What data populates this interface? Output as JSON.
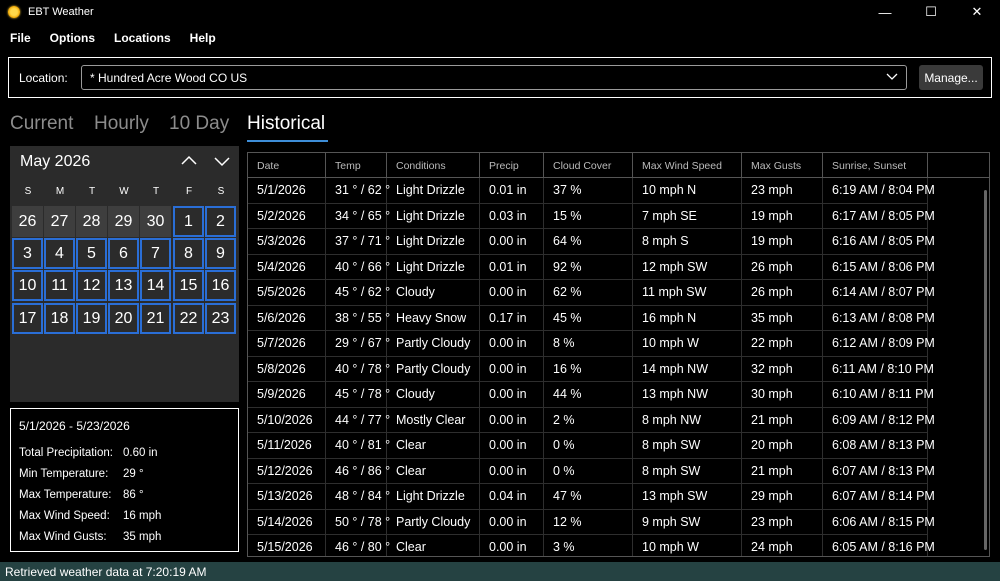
{
  "app": {
    "title": "EBT Weather"
  },
  "window_controls": {
    "minimize": "—",
    "maximize": "☐",
    "close": "✕"
  },
  "menu": [
    "File",
    "Options",
    "Locations",
    "Help"
  ],
  "location": {
    "label": "Location:",
    "value": "* Hundred Acre Wood CO US",
    "manage_label": "Manage..."
  },
  "tabs": [
    "Current",
    "Hourly",
    "10 Day",
    "Historical"
  ],
  "active_tab": "Historical",
  "calendar": {
    "month_label": "May 2026",
    "weekdays": [
      "S",
      "M",
      "T",
      "W",
      "T",
      "F",
      "S"
    ],
    "weeks": [
      [
        {
          "d": "26",
          "prev": true
        },
        {
          "d": "27",
          "prev": true
        },
        {
          "d": "28",
          "prev": true
        },
        {
          "d": "29",
          "prev": true
        },
        {
          "d": "30",
          "prev": true
        },
        {
          "d": "1"
        },
        {
          "d": "2"
        }
      ],
      [
        {
          "d": "3"
        },
        {
          "d": "4"
        },
        {
          "d": "5"
        },
        {
          "d": "6"
        },
        {
          "d": "7"
        },
        {
          "d": "8"
        },
        {
          "d": "9"
        }
      ],
      [
        {
          "d": "10"
        },
        {
          "d": "11"
        },
        {
          "d": "12"
        },
        {
          "d": "13"
        },
        {
          "d": "14"
        },
        {
          "d": "15"
        },
        {
          "d": "16"
        }
      ],
      [
        {
          "d": "17"
        },
        {
          "d": "18"
        },
        {
          "d": "19"
        },
        {
          "d": "20"
        },
        {
          "d": "21"
        },
        {
          "d": "22"
        },
        {
          "d": "23"
        }
      ]
    ]
  },
  "summary": {
    "range": "5/1/2026 - 5/23/2026",
    "rows": [
      {
        "label": "Total Precipitation:",
        "value": "0.60  in"
      },
      {
        "label": "Min Temperature:",
        "value": "29  °"
      },
      {
        "label": "Max Temperature:",
        "value": "86  °"
      },
      {
        "label": "Max Wind Speed:",
        "value": "16  mph"
      },
      {
        "label": "Max Wind Gusts:",
        "value": "35  mph"
      }
    ]
  },
  "grid": {
    "columns": [
      "Date",
      "Temp",
      "Conditions",
      "Precip",
      "Cloud Cover",
      "Max Wind Speed",
      "Max Gusts",
      "Sunrise, Sunset"
    ],
    "rows": [
      [
        "5/1/2026",
        "31 ° / 62 °",
        "Light Drizzle",
        "0.01 in",
        "37 %",
        "10 mph N",
        "23 mph",
        "6:19 AM / 8:04 PM"
      ],
      [
        "5/2/2026",
        "34 ° / 65 °",
        "Light Drizzle",
        "0.03 in",
        "15 %",
        "7 mph SE",
        "19 mph",
        "6:17 AM / 8:05 PM"
      ],
      [
        "5/3/2026",
        "37 ° / 71 °",
        "Light Drizzle",
        "0.00 in",
        "64 %",
        "8 mph S",
        "19 mph",
        "6:16 AM / 8:05 PM"
      ],
      [
        "5/4/2026",
        "40 ° / 66 °",
        "Light Drizzle",
        "0.01 in",
        "92 %",
        "12 mph SW",
        "26 mph",
        "6:15 AM / 8:06 PM"
      ],
      [
        "5/5/2026",
        "45 ° / 62 °",
        "Cloudy",
        "0.00 in",
        "62 %",
        "11 mph SW",
        "26 mph",
        "6:14 AM / 8:07 PM"
      ],
      [
        "5/6/2026",
        "38 ° / 55 °",
        "Heavy Snow",
        "0.17 in",
        "45 %",
        "16 mph N",
        "35 mph",
        "6:13 AM / 8:08 PM"
      ],
      [
        "5/7/2026",
        "29 ° / 67 °",
        "Partly Cloudy",
        "0.00 in",
        "8 %",
        "10 mph W",
        "22 mph",
        "6:12 AM / 8:09 PM"
      ],
      [
        "5/8/2026",
        "40 ° / 78 °",
        "Partly Cloudy",
        "0.00 in",
        "16 %",
        "14 mph NW",
        "32 mph",
        "6:11 AM / 8:10 PM"
      ],
      [
        "5/9/2026",
        "45 ° / 78 °",
        "Cloudy",
        "0.00 in",
        "44 %",
        "13 mph NW",
        "30 mph",
        "6:10 AM / 8:11 PM"
      ],
      [
        "5/10/2026",
        "44 ° / 77 °",
        "Mostly Clear",
        "0.00 in",
        "2 %",
        "8 mph NW",
        "21 mph",
        "6:09 AM / 8:12 PM"
      ],
      [
        "5/11/2026",
        "40 ° / 81 °",
        "Clear",
        "0.00 in",
        "0 %",
        "8 mph SW",
        "20 mph",
        "6:08 AM / 8:13 PM"
      ],
      [
        "5/12/2026",
        "46 ° / 86 °",
        "Clear",
        "0.00 in",
        "0 %",
        "8 mph SW",
        "21 mph",
        "6:07 AM / 8:13 PM"
      ],
      [
        "5/13/2026",
        "48 ° / 84 °",
        "Light Drizzle",
        "0.04 in",
        "47 %",
        "13 mph SW",
        "29 mph",
        "6:07 AM / 8:14 PM"
      ],
      [
        "5/14/2026",
        "50 ° / 78 °",
        "Partly Cloudy",
        "0.00 in",
        "12 %",
        "9 mph SW",
        "23 mph",
        "6:06 AM / 8:15 PM"
      ],
      [
        "5/15/2026",
        "46 ° / 80 °",
        "Clear",
        "0.00 in",
        "3 %",
        "10 mph W",
        "24 mph",
        "6:05 AM / 8:16 PM"
      ]
    ]
  },
  "status": {
    "text": "Retrieved weather data at 7:20:19 AM"
  },
  "colors": {
    "accent": "#3e8ed8",
    "day_border": "#2a6ed6",
    "status_bg": "#254242"
  }
}
